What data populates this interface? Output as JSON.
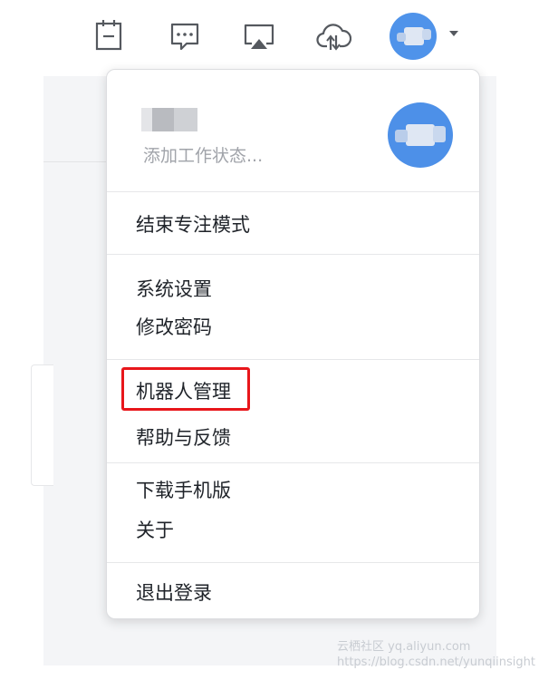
{
  "toolbar": {
    "icons": [
      "calendar-icon",
      "chat-icon",
      "screen-share-icon",
      "cloud-sync-icon"
    ],
    "avatar": "user-avatar"
  },
  "menu": {
    "profile": {
      "status_placeholder": "添加工作状态..."
    },
    "sections": [
      [
        "结束专注模式"
      ],
      [
        "系统设置",
        "修改密码"
      ],
      [
        "机器人管理",
        "帮助与反馈"
      ],
      [
        "下载手机版",
        "关于"
      ],
      [
        "退出登录"
      ]
    ],
    "highlighted_item": "机器人管理"
  },
  "watermark": {
    "line1": "云栖社区 yq.aliyun.com",
    "line2": "https://blog.csdn.net/yunqiinsight"
  },
  "colors": {
    "avatar_blue": "#4d90e8",
    "highlight_red": "#e8161b",
    "text": "#1f2329",
    "muted": "#a1a4aa"
  }
}
